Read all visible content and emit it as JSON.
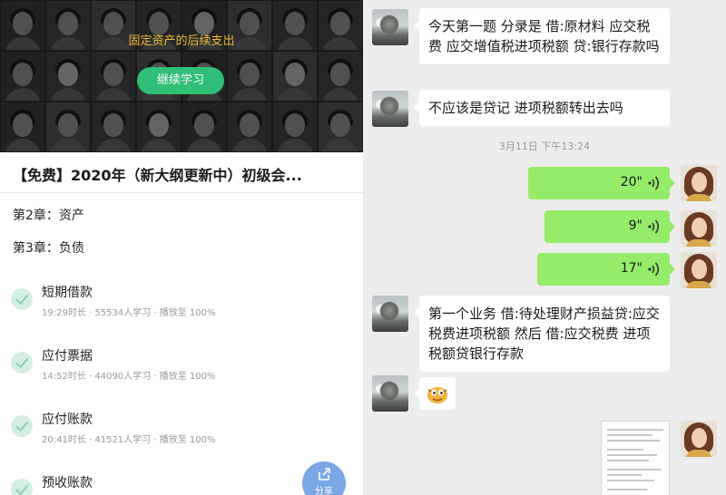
{
  "course": {
    "banner_title": "固定资产的后续支出",
    "continue_label": "继续学习",
    "title": "【免费】2020年（新大纲更新中）初级会...",
    "chapters": [
      "第2章：资产",
      "第3章：负债"
    ],
    "lessons": [
      {
        "name": "短期借款",
        "meta": "19:29时长 · 55534人学习 · 播放至 100%"
      },
      {
        "name": "应付票据",
        "meta": "14:52时长 · 44090人学习 · 播放至 100%"
      },
      {
        "name": "应付账款",
        "meta": "20:41时长 · 41521人学习 · 播放至 100%"
      },
      {
        "name": "预收账款",
        "meta": ""
      }
    ],
    "share_label": "分享"
  },
  "chat": {
    "messages": [
      {
        "text": "今天第一题  分录是 借:原材料 应交税费 应交增值税进项税额 贷:银行存款吗"
      },
      {
        "text": "不应该是贷记  进项税额转出去吗"
      },
      {
        "text": "第一个业务 借:待处理财产损益贷:应交税费进项税额  然后 借:应交税费 进项税额贷银行存款"
      }
    ],
    "timestamp": "3月11日 下午13:24",
    "voices": [
      {
        "duration": "20\""
      },
      {
        "duration": "9\""
      },
      {
        "duration": "17\""
      }
    ]
  },
  "colors": {
    "accent_green": "#2fbf76",
    "voice_bubble": "#95ec69",
    "banner_title": "#f0b93a",
    "chat_bg": "#ededed"
  }
}
